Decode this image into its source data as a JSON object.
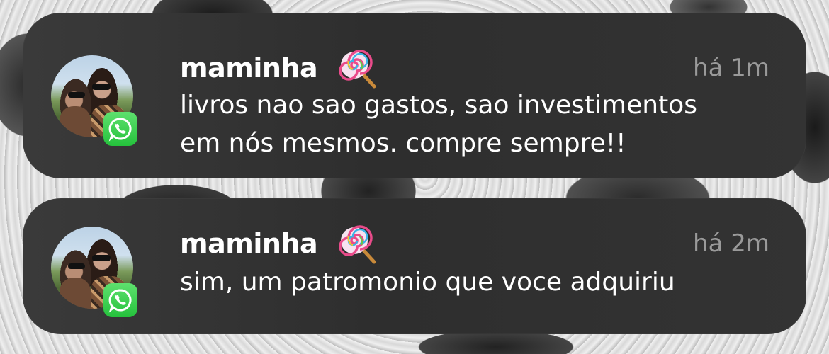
{
  "notifications": [
    {
      "app_icon": "whatsapp-icon",
      "sender": "maminha",
      "emoji": "lollipop-icon",
      "time": "há 1m",
      "message": "livros nao sao gastos, sao investimentos\nem nós mesmos. compre sempre!!"
    },
    {
      "app_icon": "whatsapp-icon",
      "sender": "maminha",
      "emoji": "lollipop-icon",
      "time": "há 2m",
      "message": "sim, um patromonio que voce adquiriu"
    }
  ],
  "colors": {
    "banner_background": "#333333",
    "sender_text": "#ffffff",
    "time_text": "#9a9a9a",
    "whatsapp_green": "#25c23c"
  }
}
